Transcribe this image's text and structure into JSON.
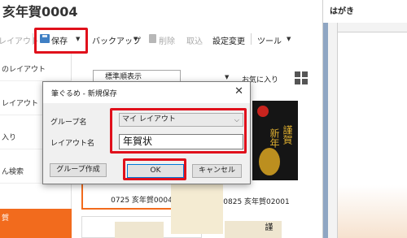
{
  "app": {
    "title": "亥年賀0004"
  },
  "toolbar": {
    "layout_label": "レイアウト",
    "save_label": "保存",
    "backup_label": "バックアップ",
    "delete_label": "削除",
    "retrieve_label": "取込",
    "settings_label": "設定変更",
    "tools_label": "ツール"
  },
  "sidebar": {
    "items": [
      {
        "label": "のレイアウト"
      },
      {
        "label": "レイアウト"
      },
      {
        "label": "入り"
      },
      {
        "label": "ん検索"
      }
    ],
    "active_label": "賀"
  },
  "grid": {
    "sort_value": "標準順表示",
    "favorites_label": "お気に入り",
    "cards": [
      {
        "label": "0725 亥年賀0004"
      },
      {
        "label": "0825 亥年賀02001"
      }
    ],
    "thumb2_text_1": "謹賀",
    "thumb2_text_2": "新年",
    "thumb3_text": "謹"
  },
  "preview": {
    "title": "はがき"
  },
  "dialog": {
    "title": "筆ぐるめ - 新規保存",
    "close_icon": "close-icon",
    "group_label": "グループ名",
    "group_value": "マイ レイアウト",
    "layout_name_label": "レイアウト名",
    "layout_name_value": "年賀状",
    "create_group_label": "グループ作成",
    "ok_label": "OK",
    "cancel_label": "キャンセル"
  },
  "colors": {
    "highlight": "#e0101b",
    "accent_orange": "#f26b1d",
    "save_icon": "#3f7fc4",
    "ok_border": "#0078d7"
  }
}
